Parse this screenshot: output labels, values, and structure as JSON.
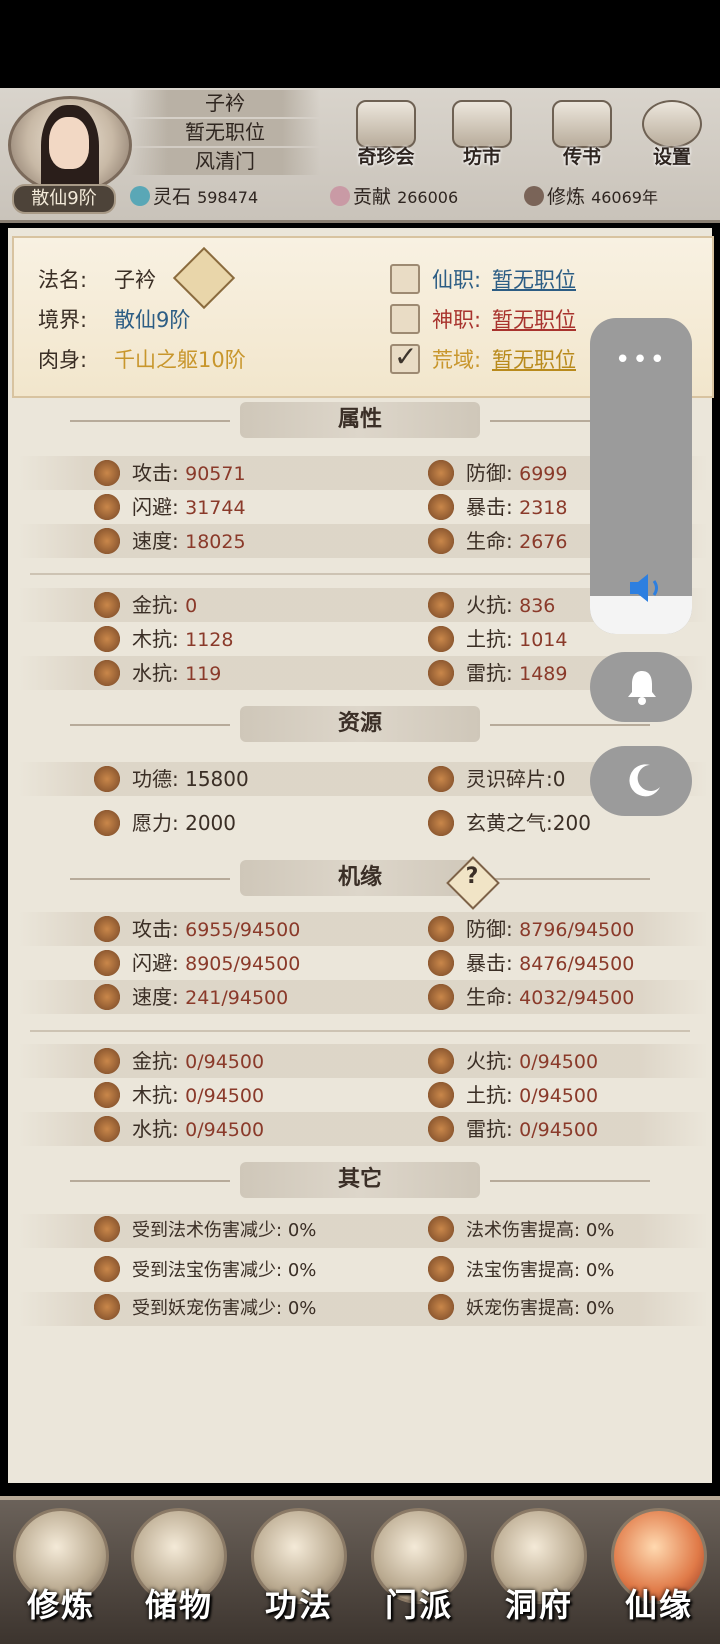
{
  "header": {
    "char_name": "子衿",
    "position": "暂无职位",
    "sect": "风清门",
    "rank": "散仙9阶",
    "top_buttons": [
      {
        "label": "奇珍会",
        "icon": "treasure-pavilion-icon"
      },
      {
        "label": "坊市",
        "icon": "market-icon"
      },
      {
        "label": "传书",
        "icon": "letter-scroll-icon"
      },
      {
        "label": "设置",
        "icon": "gear-icon"
      }
    ],
    "resources": [
      {
        "label": "灵石",
        "value": "598474",
        "color": "#5aa7b6"
      },
      {
        "label": "贡献",
        "value": "266006",
        "color": "#c99aa5"
      },
      {
        "label": "修炼",
        "value": "46069年",
        "color": "#7a6458"
      }
    ]
  },
  "info": {
    "dharma_name_label": "法名:",
    "dharma_name": "子衿",
    "realm_label": "境界:",
    "realm": "散仙9阶",
    "body_label": "肉身:",
    "body": "千山之躯10阶",
    "posts": [
      {
        "label": "仙职:",
        "value": "暂无职位",
        "checked": false
      },
      {
        "label": "神职:",
        "value": "暂无职位",
        "checked": false
      },
      {
        "label": "荒域:",
        "value": "暂无职位",
        "checked": true
      }
    ]
  },
  "attributes": {
    "title": "属性",
    "rows": [
      [
        {
          "label": "攻击:",
          "value": "90571"
        },
        {
          "label": "防御:",
          "value": "6999"
        }
      ],
      [
        {
          "label": "闪避:",
          "value": "31744"
        },
        {
          "label": "暴击:",
          "value": "2318"
        }
      ],
      [
        {
          "label": "速度:",
          "value": "18025"
        },
        {
          "label": "生命:",
          "value": "2676"
        }
      ]
    ],
    "resist_rows": [
      [
        {
          "label": "金抗:",
          "value": "0"
        },
        {
          "label": "火抗:",
          "value": "836"
        }
      ],
      [
        {
          "label": "木抗:",
          "value": "1128"
        },
        {
          "label": "土抗:",
          "value": "1014"
        }
      ],
      [
        {
          "label": "水抗:",
          "value": "119"
        },
        {
          "label": "雷抗:",
          "value": "1489"
        }
      ]
    ]
  },
  "resources_section": {
    "title": "资源",
    "rows": [
      [
        {
          "label": "功德:",
          "value": "15800"
        },
        {
          "label": "灵识碎片:",
          "value": "0"
        }
      ],
      [
        {
          "label": "愿力:",
          "value": "2000"
        },
        {
          "label": "玄黄之气:",
          "value": "200"
        }
      ]
    ]
  },
  "fortune": {
    "title": "机缘",
    "help": "?",
    "rows": [
      [
        {
          "label": "攻击:",
          "value": "6955/94500"
        },
        {
          "label": "防御:",
          "value": "8796/94500"
        }
      ],
      [
        {
          "label": "闪避:",
          "value": "8905/94500"
        },
        {
          "label": "暴击:",
          "value": "8476/94500"
        }
      ],
      [
        {
          "label": "速度:",
          "value": "241/94500"
        },
        {
          "label": "生命:",
          "value": "4032/94500"
        }
      ]
    ],
    "resist_rows": [
      [
        {
          "label": "金抗:",
          "value": "0/94500"
        },
        {
          "label": "火抗:",
          "value": "0/94500"
        }
      ],
      [
        {
          "label": "木抗:",
          "value": "0/94500"
        },
        {
          "label": "土抗:",
          "value": "0/94500"
        }
      ],
      [
        {
          "label": "水抗:",
          "value": "0/94500"
        },
        {
          "label": "雷抗:",
          "value": "0/94500"
        }
      ]
    ]
  },
  "other": {
    "title": "其它",
    "rows": [
      [
        {
          "label": "受到法术伤害减少:",
          "value": "0%"
        },
        {
          "label": "法术伤害提高:",
          "value": "0%"
        }
      ],
      [
        {
          "label": "受到法宝伤害减少:",
          "value": "0%"
        },
        {
          "label": "法宝伤害提高:",
          "value": "0%"
        }
      ],
      [
        {
          "label": "受到妖宠伤害减少:",
          "value": "0%"
        },
        {
          "label": "妖宠伤害提高:",
          "value": "0%"
        }
      ]
    ]
  },
  "overlay": {
    "menu_dots": "•••",
    "volume_level": 0.12
  },
  "bottom_nav": [
    {
      "label": "修炼",
      "active": false
    },
    {
      "label": "储物",
      "active": false
    },
    {
      "label": "功法",
      "active": false
    },
    {
      "label": "门派",
      "active": false
    },
    {
      "label": "洞府",
      "active": false
    },
    {
      "label": "仙缘",
      "active": true
    }
  ]
}
